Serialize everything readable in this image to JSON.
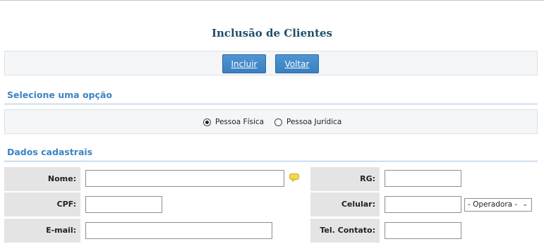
{
  "page": {
    "title": "Inclusão de Clientes"
  },
  "toolbar": {
    "incluir_label": "Incluir",
    "voltar_label": "Voltar"
  },
  "section_option": {
    "title": "Selecione uma opção"
  },
  "person_type": {
    "options": [
      {
        "label": "Pessoa Física",
        "checked": true
      },
      {
        "label": "Pessoa Jurídica",
        "checked": false
      }
    ]
  },
  "section_data": {
    "title": "Dados cadastrais"
  },
  "form": {
    "nome_label": "Nome:",
    "nome_value": "",
    "rg_label": "RG:",
    "rg_value": "",
    "cpf_label": "CPF:",
    "cpf_value": "",
    "celular_label": "Celular:",
    "celular_value": "",
    "operadora_selected": "- Operadora -",
    "email_label": "E-mail:",
    "email_value": "",
    "tel_label": "Tel. Contato:",
    "tel_value": ""
  },
  "colors": {
    "title": "#1f4e6b",
    "section": "#3b84c4",
    "button": "#3a7fc0",
    "label_bg": "#e4e4e4"
  },
  "icons": {
    "nome_help": "speech-bubble-icon",
    "select_arrow": "chevron-down-icon"
  }
}
